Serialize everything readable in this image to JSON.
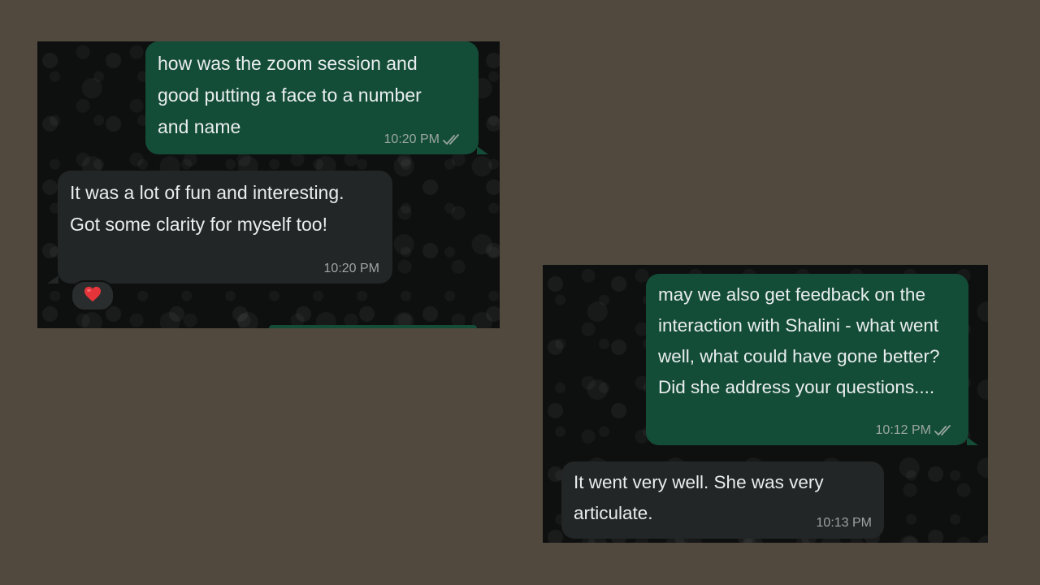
{
  "screenshots": [
    {
      "messages": [
        {
          "direction": "outgoing",
          "text": "how was the zoom session and good putting a face to a number and name",
          "time": "10:20 PM",
          "status_icon": "double-check-icon"
        },
        {
          "direction": "incoming",
          "text": "It was a lot of fun and interesting. Got some clarity for myself too!",
          "time": "10:20 PM",
          "reaction_icon": "red-heart-icon"
        }
      ]
    },
    {
      "messages": [
        {
          "direction": "outgoing",
          "text": "may we also get feedback on the interaction with Shalini - what went well, what could have gone better? Did she address your questions....",
          "time": "10:12 PM",
          "status_icon": "double-check-icon"
        },
        {
          "direction": "incoming",
          "text": "It went very well. She was very articulate.",
          "time": "10:13 PM"
        }
      ]
    }
  ],
  "colors": {
    "page_background": "#51493d",
    "chat_background": "#0e0f0f",
    "outgoing_bubble": "#144d37",
    "incoming_bubble": "#232626",
    "message_text": "#e9edef",
    "heart": "#e5353b"
  }
}
